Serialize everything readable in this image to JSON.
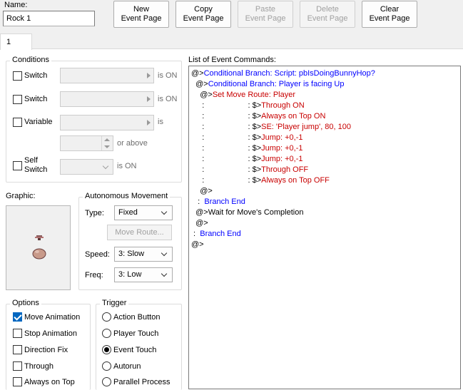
{
  "name": {
    "label": "Name:",
    "value": "Rock 1"
  },
  "toolbar": {
    "new_event_page": "New\nEvent Page",
    "copy_event_page": "Copy\nEvent Page",
    "paste_event_page": "Paste\nEvent Page",
    "delete_event_page": "Delete\nEvent Page",
    "clear_event_page": "Clear\nEvent Page"
  },
  "tabs": [
    {
      "label": "1"
    }
  ],
  "conditions": {
    "title": "Conditions",
    "switch1_label": "Switch",
    "switch1_suffix": "is ON",
    "switch2_label": "Switch",
    "switch2_suffix": "is ON",
    "variable_label": "Variable",
    "variable_suffix": "is",
    "or_above": "or above",
    "self_switch_label": "Self\nSwitch",
    "self_switch_suffix": "is ON"
  },
  "graphic": {
    "label": "Graphic:"
  },
  "autonomous_movement": {
    "title": "Autonomous Movement",
    "type_label": "Type:",
    "type_value": "Fixed",
    "move_route_button": "Move Route...",
    "speed_label": "Speed:",
    "speed_value": "3: Slow",
    "freq_label": "Freq:",
    "freq_value": "3: Low"
  },
  "options": {
    "title": "Options",
    "move_animation": "Move Animation",
    "stop_animation": "Stop Animation",
    "direction_fix": "Direction Fix",
    "through": "Through",
    "always_on_top": "Always on Top"
  },
  "trigger": {
    "title": "Trigger",
    "action_button": "Action Button",
    "player_touch": "Player Touch",
    "event_touch": "Event Touch",
    "autorun": "Autorun",
    "parallel_process": "Parallel Process"
  },
  "command_list": {
    "label": "List of Event Commands:",
    "lines": [
      {
        "indent": "",
        "prefix": "@>",
        "text": "Conditional Branch: Script: pbIsDoingBunnyHop?",
        "color": "blue"
      },
      {
        "indent": "  ",
        "prefix": "@>",
        "text": "Conditional Branch: Player is facing Up",
        "color": "blue"
      },
      {
        "indent": "    ",
        "prefix": "@>",
        "text": "Set Move Route: Player",
        "color": "red"
      },
      {
        "indent": "     :",
        "prefix": "                    : $>",
        "text": "Through ON",
        "color": "red"
      },
      {
        "indent": "     :",
        "prefix": "                    : $>",
        "text": "Always on Top ON",
        "color": "red"
      },
      {
        "indent": "     :",
        "prefix": "                    : $>",
        "text": "SE: 'Player jump', 80, 100",
        "color": "red"
      },
      {
        "indent": "     :",
        "prefix": "                    : $>",
        "text": "Jump: +0,-1",
        "color": "red"
      },
      {
        "indent": "     :",
        "prefix": "                    : $>",
        "text": "Jump: +0,-1",
        "color": "red"
      },
      {
        "indent": "     :",
        "prefix": "                    : $>",
        "text": "Jump: +0,-1",
        "color": "red"
      },
      {
        "indent": "     :",
        "prefix": "                    : $>",
        "text": "Through OFF",
        "color": "red"
      },
      {
        "indent": "     :",
        "prefix": "                    : $>",
        "text": "Always on Top OFF",
        "color": "red"
      },
      {
        "indent": "    ",
        "prefix": "@>",
        "text": "",
        "color": "black"
      },
      {
        "indent": "   :",
        "prefix": "  ",
        "text": "Branch End",
        "color": "blue"
      },
      {
        "indent": "  ",
        "prefix": "@>",
        "text": "Wait for Move's Completion",
        "color": "black"
      },
      {
        "indent": "  ",
        "prefix": "@>",
        "text": "",
        "color": "black"
      },
      {
        "indent": " :",
        "prefix": "  ",
        "text": "Branch End",
        "color": "blue"
      },
      {
        "indent": "",
        "prefix": "@>",
        "text": "",
        "color": "black"
      }
    ]
  },
  "colors": {
    "accent": "#0067c0",
    "command_blue": "#0000ff",
    "command_red": "#c80000"
  }
}
